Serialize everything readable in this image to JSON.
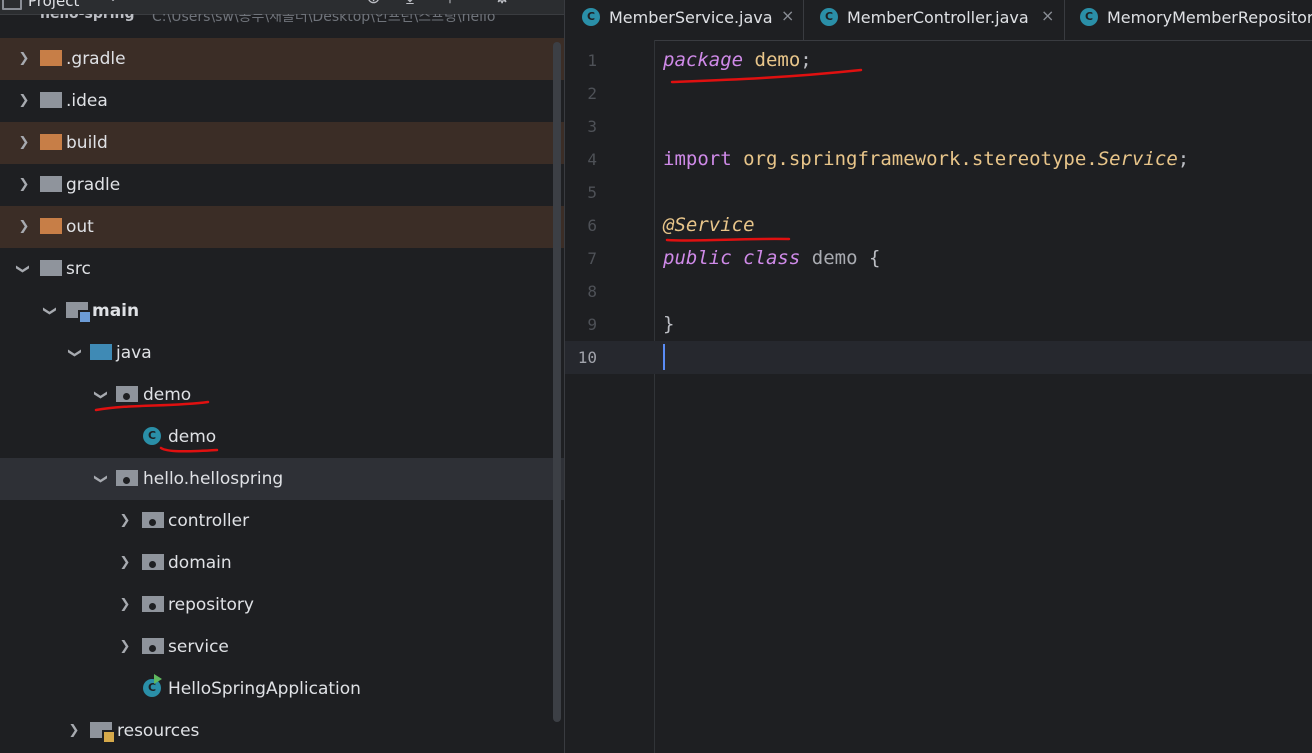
{
  "project_header": {
    "title": "Project",
    "dropdown": "⌄",
    "project_name": "hello-spring",
    "project_path": "C:\\Users\\sw\\공부\\새폴더\\Desktop\\인프런\\스프링\\hello"
  },
  "tree": [
    {
      "label": ".gradle",
      "expanded": false,
      "excluded": true
    },
    {
      "label": ".idea",
      "expanded": false,
      "excluded": false
    },
    {
      "label": "build",
      "expanded": false,
      "excluded": true
    },
    {
      "label": "gradle",
      "expanded": false,
      "excluded": false
    },
    {
      "label": "out",
      "expanded": false,
      "excluded": true
    },
    {
      "label": "src",
      "expanded": true
    },
    {
      "label": "main",
      "expanded": true
    },
    {
      "label": "java",
      "expanded": true
    },
    {
      "label": "demo",
      "expanded": true
    },
    {
      "label": "demo"
    },
    {
      "label": "hello.hellospring",
      "expanded": true,
      "selected": true
    },
    {
      "label": "controller",
      "expanded": false
    },
    {
      "label": "domain",
      "expanded": false
    },
    {
      "label": "repository",
      "expanded": false
    },
    {
      "label": "service",
      "expanded": false
    },
    {
      "label": "HelloSpringApplication"
    },
    {
      "label": "resources",
      "expanded": false
    }
  ],
  "tabs": [
    {
      "label": "MemberService.java",
      "close": "×"
    },
    {
      "label": "MemberController.java",
      "close": "×"
    },
    {
      "label": "MemoryMemberRepository.java",
      "close": ""
    }
  ],
  "class_icon_letter": "C",
  "editor": {
    "line_numbers": [
      "1",
      "2",
      "3",
      "4",
      "5",
      "6",
      "7",
      "8",
      "9",
      "10"
    ],
    "current_line": 10,
    "code": {
      "l1_kw": "package",
      "l1_pkg": "demo",
      "l1_semi": ";",
      "l4_kw": "import",
      "l4_pkg": "org.springframework.stereotype.",
      "l4_cls": "Service",
      "l4_semi": ";",
      "l6_anno": "@Service",
      "l7_kw1": "public",
      "l7_kw2": "class",
      "l7_name": "demo",
      "l7_brace": "{",
      "l9_brace": "}"
    }
  },
  "colors": {
    "keyword": "#cf8ae8",
    "annotation": "#e8c58a",
    "excluded_folder": "#c77e47",
    "source_folder": "#3f8ab5",
    "annotation_ink": "#e01010"
  }
}
